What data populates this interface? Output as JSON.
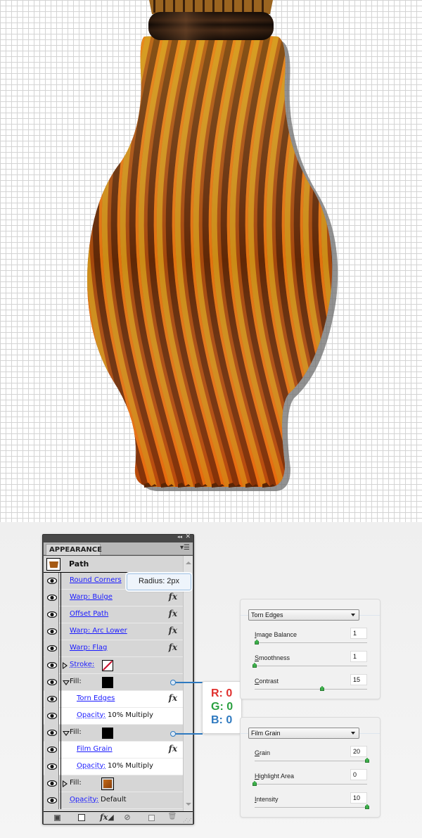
{
  "appearance_panel": {
    "tab_label": "APPEARANCE",
    "collapse_icon": "double-chevron-left-icon",
    "close_icon": "close-icon",
    "menu_icon": "panel-menu-icon",
    "header": {
      "title": "Path",
      "thumbnail_color": "#a55a14"
    },
    "rows": [
      {
        "type": "effect",
        "label": "Round Corners",
        "fx": false,
        "bg": "grey"
      },
      {
        "type": "effect",
        "label": "Warp: Bulge",
        "fx": true,
        "bg": "grey"
      },
      {
        "type": "effect",
        "label": "Offset Path",
        "fx": true,
        "bg": "grey"
      },
      {
        "type": "effect",
        "label": "Warp: Arc Lower",
        "fx": true,
        "bg": "grey"
      },
      {
        "type": "effect",
        "label": "Warp: Flag",
        "fx": true,
        "bg": "grey"
      },
      {
        "type": "stroke",
        "label": "Stroke:",
        "swatch": "none",
        "expanded": false,
        "bg": "grey"
      },
      {
        "type": "fill",
        "label": "Fill:",
        "swatch": "#000000",
        "expanded": true,
        "bg": "grey"
      },
      {
        "type": "sub-effect",
        "label": "Torn Edges",
        "fx": true,
        "bg": "white"
      },
      {
        "type": "opacity",
        "label": "Opacity:",
        "value": "10% Multiply",
        "bg": "white"
      },
      {
        "type": "fill",
        "label": "Fill:",
        "swatch": "#000000",
        "expanded": true,
        "bg": "grey"
      },
      {
        "type": "sub-effect",
        "label": "Film Grain",
        "fx": true,
        "bg": "white"
      },
      {
        "type": "opacity",
        "label": "Opacity:",
        "value": "10% Multiply",
        "bg": "white"
      },
      {
        "type": "fill",
        "label": "Fill:",
        "swatch": "#a55a14",
        "expanded": false,
        "bg": "grey"
      },
      {
        "type": "opacity-root",
        "label": "Opacity:",
        "value": "Default",
        "bg": "grey"
      }
    ],
    "footer_buttons": [
      "add-new-art-icon",
      "add-new-fill-icon",
      "add-new-effect-icon",
      "clear-appearance-icon",
      "duplicate-item-icon",
      "delete-item-icon"
    ],
    "fx_glyph": "fx"
  },
  "tooltip": {
    "text": "Radius: 2px"
  },
  "rgb_callout": {
    "r": "R: 0",
    "g": "G: 0",
    "b": "B: 0"
  },
  "torn_edges_dialog": {
    "filter": "Torn Edges",
    "sliders": [
      {
        "label": "Image Balance",
        "accel": "I",
        "rest": "mage Balance",
        "value": "1",
        "fraction": 0.02
      },
      {
        "label": "Smoothness",
        "accel": "S",
        "rest": "moothness",
        "value": "1",
        "fraction": 0.0
      },
      {
        "label": "Contrast",
        "accel": "C",
        "rest": "ontrast",
        "value": "15",
        "fraction": 0.6
      }
    ]
  },
  "film_grain_dialog": {
    "filter": "Film Grain",
    "sliders": [
      {
        "label": "Grain",
        "accel": "G",
        "rest": "rain",
        "value": "20",
        "fraction": 1.0
      },
      {
        "label": "Highlight Area",
        "accel": "H",
        "rest": "ighlight Area",
        "value": "0",
        "fraction": 0.0
      },
      {
        "label": "Intensity",
        "accel": "I",
        "rest": "ntensity",
        "value": "10",
        "fraction": 1.0
      }
    ]
  },
  "colors": {
    "stripe_dark": "#5a2505",
    "stripe_mid": "#a5480c",
    "stripe_orange": "#e8760e",
    "stripe_gold": "#d9a21a",
    "cap_dark": "#2a1a10",
    "shadow": "#6d6d6d",
    "connector": "#2f7ac0"
  }
}
